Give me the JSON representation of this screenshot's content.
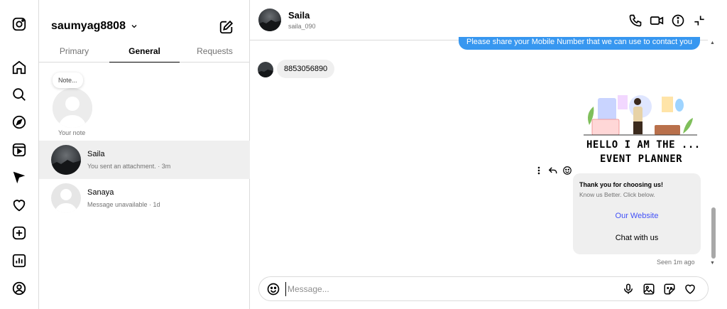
{
  "rail": {
    "icons": [
      "instagram-icon",
      "home-icon",
      "search-icon",
      "explore-icon",
      "reels-icon",
      "messages-icon",
      "notifications-icon",
      "create-icon",
      "dashboard-icon",
      "profile-icon"
    ]
  },
  "list": {
    "username": "saumyag8808",
    "tabs": [
      {
        "label": "Primary"
      },
      {
        "label": "General"
      },
      {
        "label": "Requests"
      }
    ],
    "active_tab": "General",
    "note": {
      "bubble": "Note...",
      "label": "Your note"
    },
    "conversations": [
      {
        "name": "Saila",
        "subtitle": "You sent an attachment. · 3m",
        "selected": true
      },
      {
        "name": "Sanaya",
        "subtitle": "Message unavailable · 1d",
        "selected": false
      }
    ]
  },
  "chat": {
    "name": "Saila",
    "handle": "saila_090",
    "messages": {
      "outgoing_top": "Please share your Mobile Number that we can use to contact you",
      "incoming": "8853056890",
      "card_image_line1": "HELLO I AM THE ...",
      "card_image_line2": "EVENT PLANNER",
      "card_title": "Thank you for choosing us!",
      "card_subtitle": "Know us Better. Click below.",
      "card_button_1": "Our Website",
      "card_button_2": "Chat with us",
      "seen": "Seen 1m ago"
    },
    "composer": {
      "placeholder": "Message..."
    }
  },
  "colors": {
    "accent_blue": "#3797f0",
    "link_blue": "#4150f7",
    "bubble_gray": "#efefef",
    "border": "#dbdbdb"
  }
}
